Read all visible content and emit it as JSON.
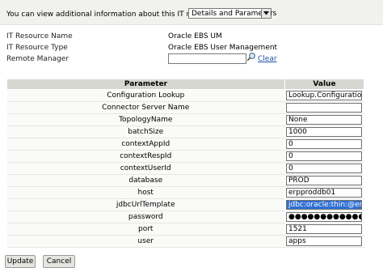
{
  "header": {
    "intro_text": "You can view additional information about this IT resource :",
    "view_select": {
      "selected": "Details and Parameters"
    }
  },
  "resource_info": [
    {
      "label": "IT Resource Name",
      "value": "Oracle EBS UM"
    },
    {
      "label": "IT Resource Type",
      "value": "Oracle EBS User Management"
    }
  ],
  "remote_manager": {
    "label": "Remote Manager",
    "value": "",
    "clear_label": "Clear"
  },
  "table": {
    "headers": {
      "parameter": "Parameter",
      "value": "Value"
    },
    "rows": [
      {
        "name": "Configuration Lookup",
        "value": "Lookup.Configuration.Or"
      },
      {
        "name": "Connector Server Name",
        "value": ""
      },
      {
        "name": "TopologyName",
        "value": "None"
      },
      {
        "name": "batchSize",
        "value": "1000"
      },
      {
        "name": "contextAppId",
        "value": "0"
      },
      {
        "name": "contextRespId",
        "value": "0"
      },
      {
        "name": "contextUserId",
        "value": "0"
      },
      {
        "name": "database",
        "value": "PROD"
      },
      {
        "name": "host",
        "value": "erpproddb01"
      },
      {
        "name": "jdbcUrlTemplate",
        "value": "jdbc:oracle:thin:@erppro",
        "selected": true
      },
      {
        "name": "password",
        "value": "●●●●●●●●●●●●●●"
      },
      {
        "name": "port",
        "value": "1521"
      },
      {
        "name": "user",
        "value": "apps"
      }
    ]
  },
  "buttons": {
    "update": "Update",
    "cancel": "Cancel"
  },
  "icons": {
    "search": "search-icon",
    "dropdown": "chevron-down-icon"
  },
  "colors": {
    "link": "#1f4ea3",
    "selection": "#2f6fd4",
    "header_bg": "#d7d7d2"
  }
}
